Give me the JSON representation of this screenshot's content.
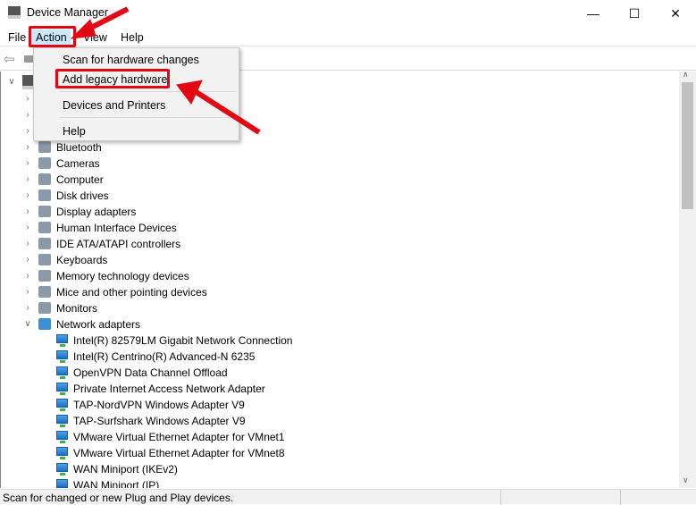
{
  "window": {
    "title": "Device Manager",
    "minimize": "—",
    "maximize": "☐",
    "close": "✕"
  },
  "menubar": [
    "File",
    "Action",
    "View",
    "Help"
  ],
  "action_menu": {
    "items": [
      "Scan for hardware changes",
      "Add legacy hardware",
      "Devices and Printers",
      "Help"
    ],
    "highlighted": "Add legacy hardware"
  },
  "tree": {
    "categories": [
      {
        "label": "Bluetooth",
        "icon": "bluetooth-icon"
      },
      {
        "label": "Cameras",
        "icon": "camera-icon"
      },
      {
        "label": "Computer",
        "icon": "computer-icon"
      },
      {
        "label": "Disk drives",
        "icon": "disk-icon"
      },
      {
        "label": "Display adapters",
        "icon": "display-icon"
      },
      {
        "label": "Human Interface Devices",
        "icon": "hid-icon"
      },
      {
        "label": "IDE ATA/ATAPI controllers",
        "icon": "ide-icon"
      },
      {
        "label": "Keyboards",
        "icon": "keyboard-icon"
      },
      {
        "label": "Memory technology devices",
        "icon": "memory-icon"
      },
      {
        "label": "Mice and other pointing devices",
        "icon": "mouse-icon"
      },
      {
        "label": "Monitors",
        "icon": "monitor-icon"
      },
      {
        "label": "Network adapters",
        "icon": "network-icon",
        "expanded": true
      }
    ],
    "network_children": [
      "Intel(R) 82579LM Gigabit Network Connection",
      "Intel(R) Centrino(R) Advanced-N 6235",
      "OpenVPN Data Channel Offload",
      "Private Internet Access Network Adapter",
      "TAP-NordVPN Windows Adapter V9",
      "TAP-Surfshark Windows Adapter V9",
      "VMware Virtual Ethernet Adapter for VMnet1",
      "VMware Virtual Ethernet Adapter for VMnet8",
      "WAN Miniport (IKEv2)",
      "WAN Miniport (IP)"
    ]
  },
  "status": "Scan for changed or new Plug and Play devices.",
  "colors": {
    "annotation": "#e30613",
    "menu_hover": "#cce8ff"
  }
}
